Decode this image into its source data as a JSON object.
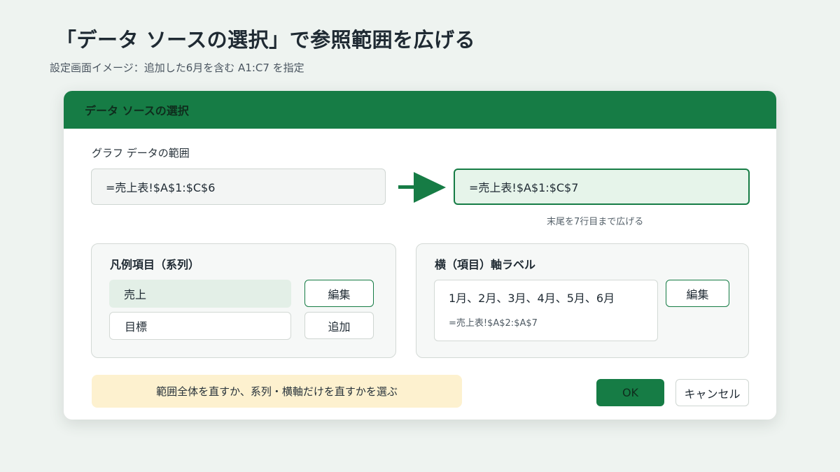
{
  "page": {
    "title": "「データ ソースの選択」で参照範囲を広げる",
    "subtitle": "設定画面イメージ：追加した6月を含む A1:C7 を指定"
  },
  "dialog": {
    "title": "データ ソースの選択",
    "range_label": "グラフ データの範囲",
    "range_old": "=売上表!$A$1:$C$6",
    "range_new": "=売上表!$A$1:$C$7",
    "range_note": "末尾を7行目まで広げる",
    "legend": {
      "heading": "凡例項目（系列）",
      "items": [
        "売上",
        "目標"
      ],
      "selected_index": 0,
      "edit_label": "編集",
      "add_label": "追加"
    },
    "axis": {
      "heading": "横（項目）軸ラベル",
      "values": "1月、2月、3月、4月、5月、6月",
      "reference": "=売上表!$A$2:$A$7",
      "edit_label": "編集"
    },
    "hint": "範囲全体を直すか、系列・横軸だけを直すかを選ぶ",
    "ok_label": "OK",
    "cancel_label": "キャンセル"
  },
  "icons": {
    "arrow": "arrow-right-icon"
  },
  "colors": {
    "accent": "#167c45",
    "selected_bg": "#e3efe7",
    "new_range_bg": "#e6f4ea",
    "hint_bg": "#fdf1cf",
    "page_bg": "#eef3f0"
  }
}
